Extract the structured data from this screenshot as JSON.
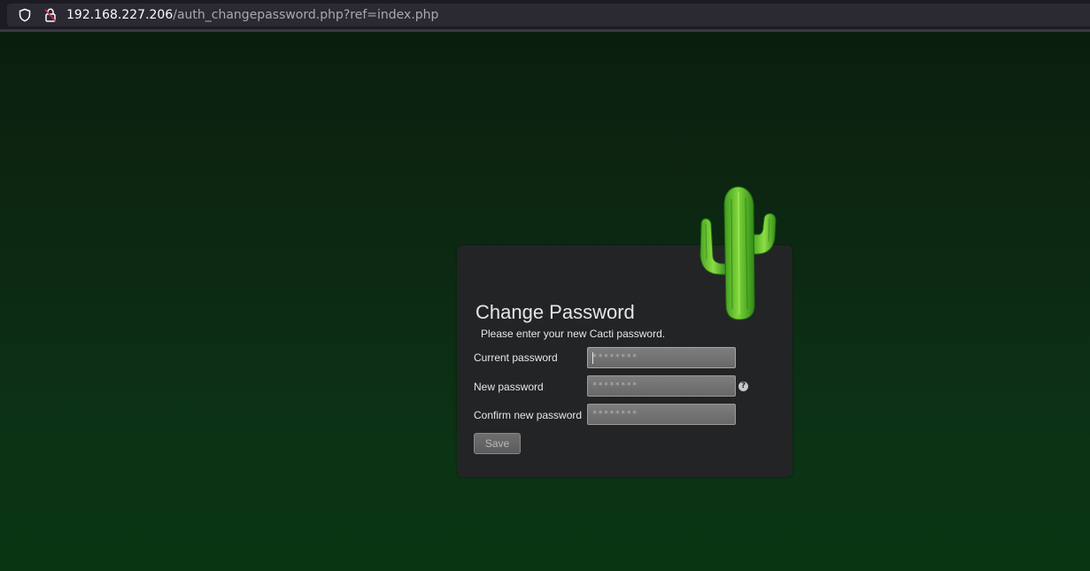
{
  "browser": {
    "url_host": "192.168.227.206",
    "url_path": "/auth_changepassword.php?ref=index.php",
    "icons": [
      "shield-icon",
      "lock-icon"
    ]
  },
  "form": {
    "title": "Change Password",
    "subtitle": "Please enter your new Cacti password.",
    "fields": [
      {
        "label": "Current password",
        "placeholder": "********",
        "value": ""
      },
      {
        "label": "New password",
        "placeholder": "********",
        "value": ""
      },
      {
        "label": "Confirm new password",
        "placeholder": "********",
        "value": ""
      }
    ],
    "help_icon": "?",
    "save_label": "Save",
    "logo": "cactus-logo"
  },
  "colors": {
    "page_background": "#0c2a12",
    "panel_background": "#232426",
    "text": "#e6e6e6",
    "input_background": "#727272",
    "urlbar_background": "#2b2a33"
  }
}
